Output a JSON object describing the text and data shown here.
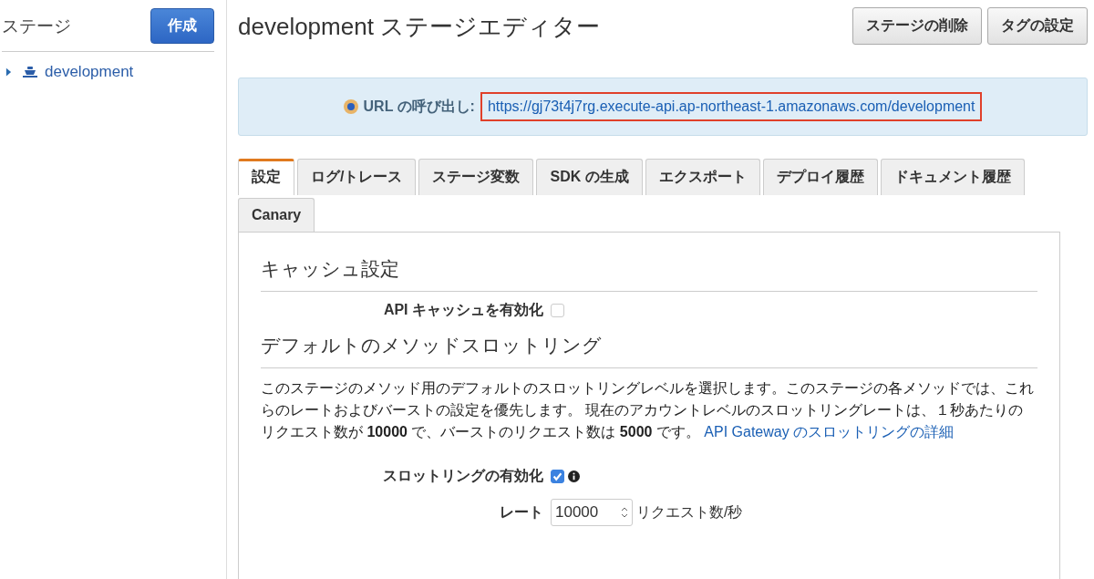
{
  "sidebar": {
    "title": "ステージ",
    "create_button": "作成",
    "stages": [
      {
        "name": "development",
        "expanded": false
      }
    ]
  },
  "header": {
    "title": "development ステージエディター",
    "buttons": [
      "ステージの削除",
      "タグの設定"
    ]
  },
  "invoke_url": {
    "label": "URL の呼び出し:",
    "url": "https://gj73t4j7rg.execute-api.ap-northeast-1.amazonaws.com/development",
    "highlighted": true
  },
  "tabs": [
    {
      "label": "設定",
      "selected": true
    },
    {
      "label": "ログ/トレース",
      "selected": false
    },
    {
      "label": "ステージ変数",
      "selected": false
    },
    {
      "label": "SDK の生成",
      "selected": false
    },
    {
      "label": "エクスポート",
      "selected": false
    },
    {
      "label": "デプロイ履歴",
      "selected": false
    },
    {
      "label": "ドキュメント履歴",
      "selected": false
    },
    {
      "label": "Canary",
      "selected": false
    }
  ],
  "cache_settings": {
    "heading": "キャッシュ設定",
    "enable_cache": {
      "label": "API キャッシュを有効化",
      "checked": false
    }
  },
  "throttling": {
    "heading": "デフォルトのメソッドスロットリング",
    "description": "このステージのメソッド用のデフォルトのスロットリングレベルを選択します。このステージの各メソッドでは、これらのレートおよびバーストの設定を優先します。 現在のアカウントレベルのスロットリングレートは、１秒あたりのリクエスト数が **10000** で、バーストのリクエスト数は **5000** です。",
    "link": "API Gateway のスロットリングの詳細",
    "enable_throttling": {
      "label": "スロットリングの有効化",
      "checked": true
    },
    "rate": {
      "label": "レート",
      "value": "10000",
      "unit": "リクエスト数/秒"
    }
  }
}
